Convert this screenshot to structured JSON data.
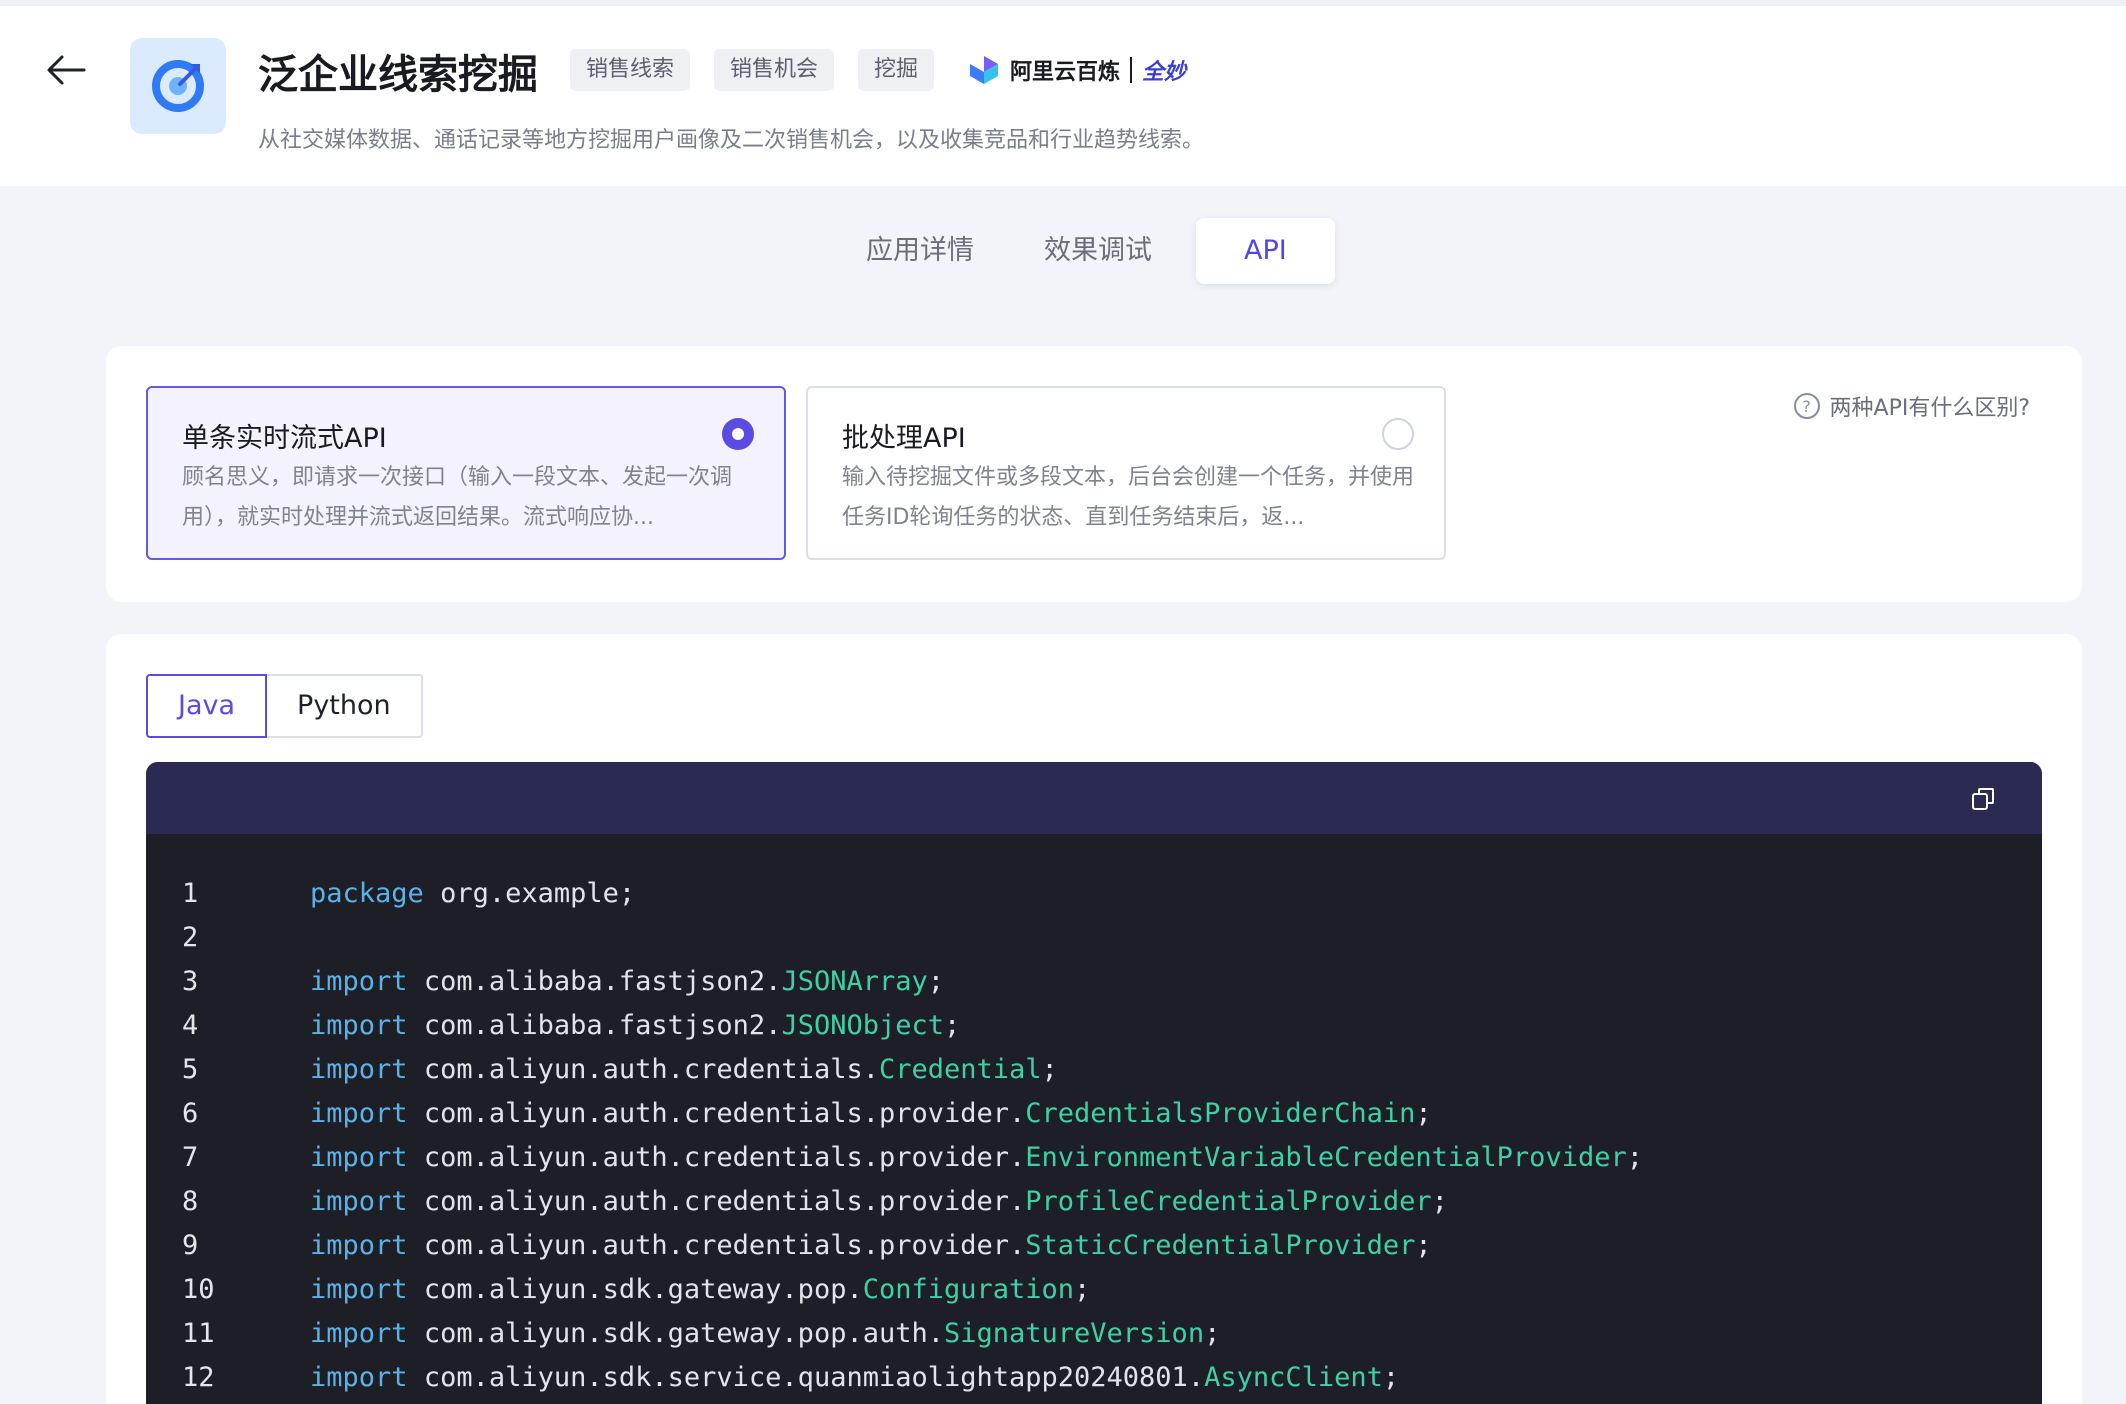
{
  "header": {
    "title": "泛企业线索挖掘",
    "tags": [
      "销售线索",
      "销售机会",
      "挖掘"
    ],
    "brand_name": "阿里云百炼",
    "brand_sub": "全妙",
    "description": "从社交媒体数据、通话记录等地方挖掘用户画像及二次销售机会，以及收集竞品和行业趋势线索。",
    "back_icon": "arrow-left-icon",
    "app_icon": "target-icon"
  },
  "tabs": [
    {
      "label": "应用详情",
      "active": false
    },
    {
      "label": "效果调试",
      "active": false
    },
    {
      "label": "API",
      "active": true
    }
  ],
  "api_options": [
    {
      "title": "单条实时流式API",
      "desc": "顾名思义，即请求一次接口（输入一段文本、发起一次调用），就实时处理并流式返回结果。流式响应协...",
      "selected": true
    },
    {
      "title": "批处理API",
      "desc": "输入待挖掘文件或多段文本，后台会创建一个任务，并使用任务ID轮询任务的状态、直到任务结束后，返...",
      "selected": false
    }
  ],
  "help_text": "两种API有什么区别?",
  "languages": [
    {
      "label": "Java",
      "active": true
    },
    {
      "label": "Python",
      "active": false
    }
  ],
  "code": [
    {
      "n": "1",
      "kw": "package",
      "pkg": "org.example",
      "cls": "",
      "end": ";"
    },
    {
      "n": "2",
      "kw": "",
      "pkg": "",
      "cls": "",
      "end": ""
    },
    {
      "n": "3",
      "kw": "import",
      "pkg": "com.alibaba.fastjson2.",
      "cls": "JSONArray",
      "end": ";"
    },
    {
      "n": "4",
      "kw": "import",
      "pkg": "com.alibaba.fastjson2.",
      "cls": "JSONObject",
      "end": ";"
    },
    {
      "n": "5",
      "kw": "import",
      "pkg": "com.aliyun.auth.credentials.",
      "cls": "Credential",
      "end": ";"
    },
    {
      "n": "6",
      "kw": "import",
      "pkg": "com.aliyun.auth.credentials.provider.",
      "cls": "CredentialsProviderChain",
      "end": ";"
    },
    {
      "n": "7",
      "kw": "import",
      "pkg": "com.aliyun.auth.credentials.provider.",
      "cls": "EnvironmentVariableCredentialProvider",
      "end": ";"
    },
    {
      "n": "8",
      "kw": "import",
      "pkg": "com.aliyun.auth.credentials.provider.",
      "cls": "ProfileCredentialProvider",
      "end": ";"
    },
    {
      "n": "9",
      "kw": "import",
      "pkg": "com.aliyun.auth.credentials.provider.",
      "cls": "StaticCredentialProvider",
      "end": ";"
    },
    {
      "n": "10",
      "kw": "import",
      "pkg": "com.aliyun.sdk.gateway.pop.",
      "cls": "Configuration",
      "end": ";"
    },
    {
      "n": "11",
      "kw": "import",
      "pkg": "com.aliyun.sdk.gateway.pop.auth.",
      "cls": "SignatureVersion",
      "end": ";"
    },
    {
      "n": "12",
      "kw": "import",
      "pkg": "com.aliyun.sdk.service.quanmiaolightapp20240801.",
      "cls": "AsyncClient",
      "end": ";"
    }
  ],
  "colors": {
    "accent": "#5b4be3",
    "code_bg": "#1e1f26",
    "code_header": "#2b2a52",
    "keyword": "#5ab2e8",
    "class": "#3fd0a6"
  }
}
